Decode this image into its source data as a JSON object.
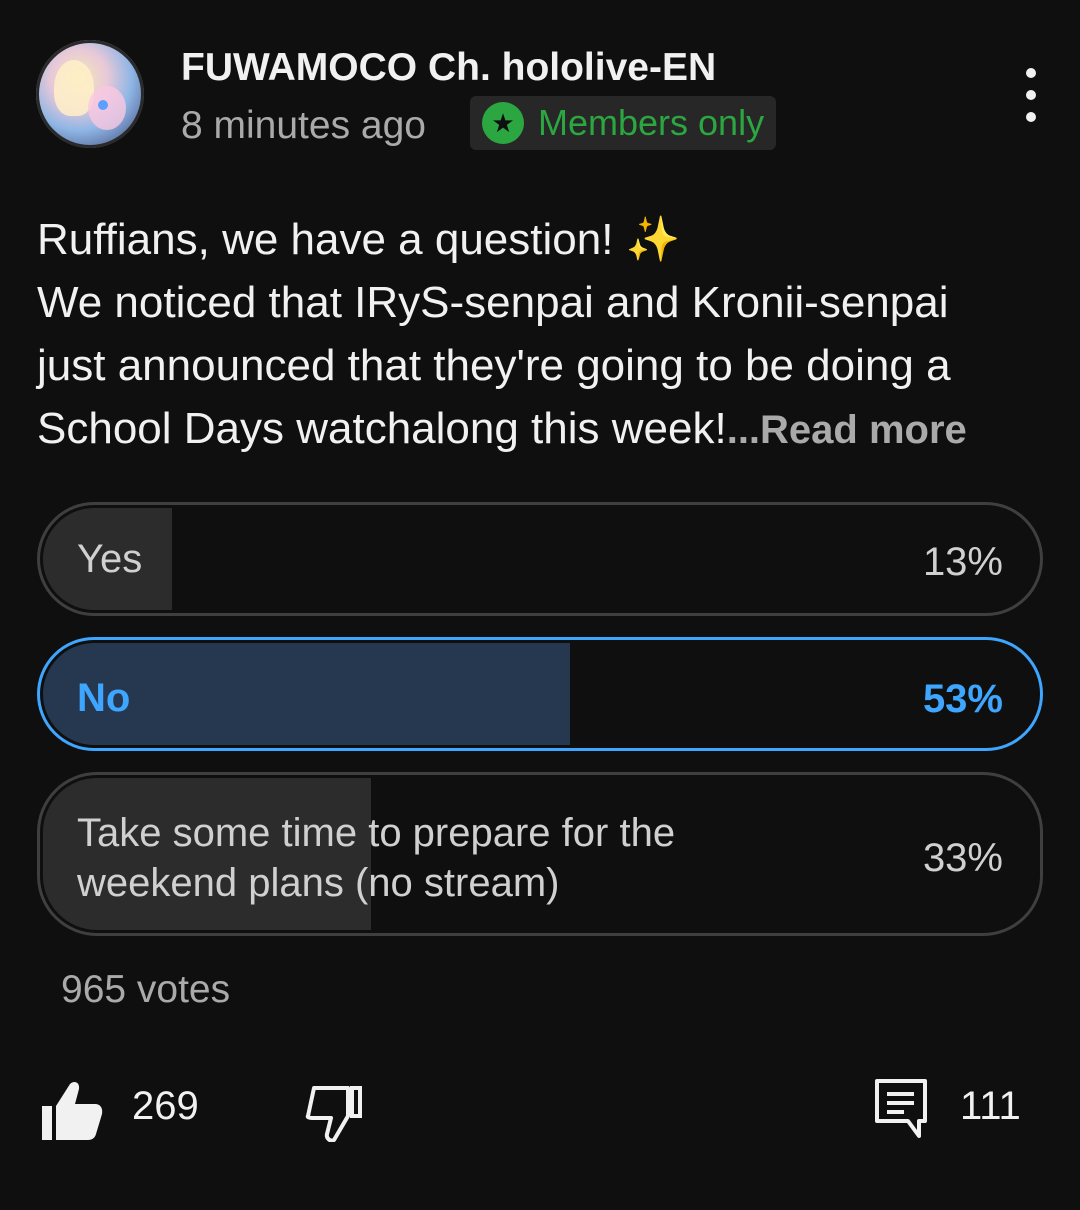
{
  "header": {
    "channel_name": "FUWAMOCO Ch. hololive-EN",
    "time_ago": "8 minutes ago",
    "members_badge": "Members only"
  },
  "post": {
    "lines": [
      "Ruffians, we have a question! ✨",
      "We noticed that IRyS-senpai and Kronii-senpai",
      "just announced that they're going to be doing a",
      "School Days watchalong this week!"
    ],
    "read_more": "...Read more"
  },
  "poll": {
    "options": [
      {
        "label": "Yes",
        "percent": "13%",
        "fill_fraction": 0.13,
        "selected": false
      },
      {
        "label": "No",
        "percent": "53%",
        "fill_fraction": 0.53,
        "selected": true
      },
      {
        "label_line1": "Take some time to prepare for the",
        "label_line2": "weekend plans (no stream)",
        "percent": "33%",
        "fill_fraction": 0.33,
        "selected": false
      }
    ],
    "votes": "965 votes"
  },
  "actions": {
    "like_count": "269",
    "comment_count": "111"
  },
  "icons": [
    "more-vert-icon",
    "star-icon",
    "thumbs-up-icon",
    "thumbs-down-icon",
    "comment-icon"
  ],
  "colors": {
    "accent": "#3ea6ff",
    "members_green": "#2ba640",
    "background": "#0f0f0f"
  }
}
